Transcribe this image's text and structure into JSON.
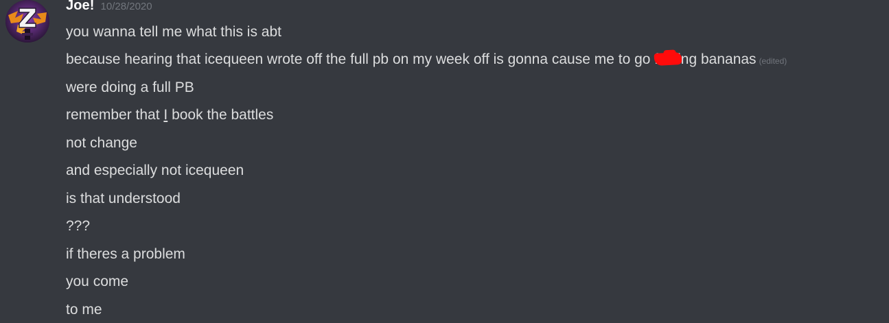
{
  "message": {
    "author": "Joe!",
    "timestamp": "10/28/2020",
    "avatar_icon": "z-logo-avatar",
    "line1": "you wanna tell me what this is abt",
    "line2": {
      "before": "because hearing that icequeen wrote off the full pb on my week off is gonna cause me to go f",
      "after": "ing bananas",
      "edited_label": "(edited)"
    },
    "line3": "were doing a full PB",
    "line4": {
      "before": "remember that ",
      "underlined": "I",
      "after": " book the battles"
    },
    "line5": "not change",
    "line6": "and especially not icequeen",
    "line7": "is that understood",
    "line8": "???",
    "line9": "if theres a problem",
    "line10": "you come",
    "line11": "to me"
  },
  "colors": {
    "background": "#36393f",
    "username": "#ffffff",
    "text": "#dcddde",
    "muted": "#72767d",
    "redaction": "#ff0b0b"
  }
}
